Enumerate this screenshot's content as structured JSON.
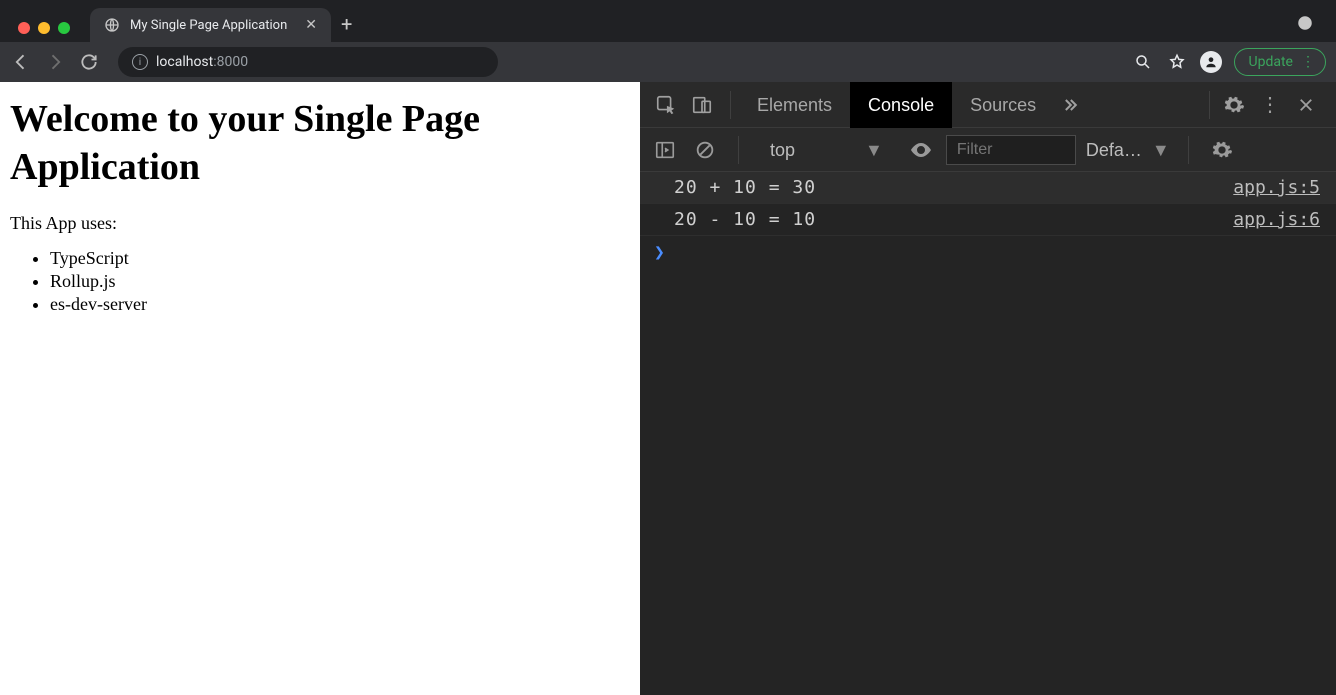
{
  "browser": {
    "tab_title": "My Single Page Application",
    "url_host": "localhost",
    "url_port": ":8000",
    "update_label": "Update"
  },
  "page": {
    "heading": "Welcome to your Single Page Application",
    "intro": "This App uses:",
    "items": [
      "TypeScript",
      "Rollup.js",
      "es-dev-server"
    ]
  },
  "devtools": {
    "tabs": {
      "elements": "Elements",
      "console": "Console",
      "sources": "Sources"
    },
    "context_label": "top",
    "filter_placeholder": "Filter",
    "levels_label": "Defa…",
    "logs": [
      {
        "text": "20 + 10 = 30",
        "source": "app.js:5"
      },
      {
        "text": "20 - 10 = 10",
        "source": "app.js:6"
      }
    ]
  }
}
